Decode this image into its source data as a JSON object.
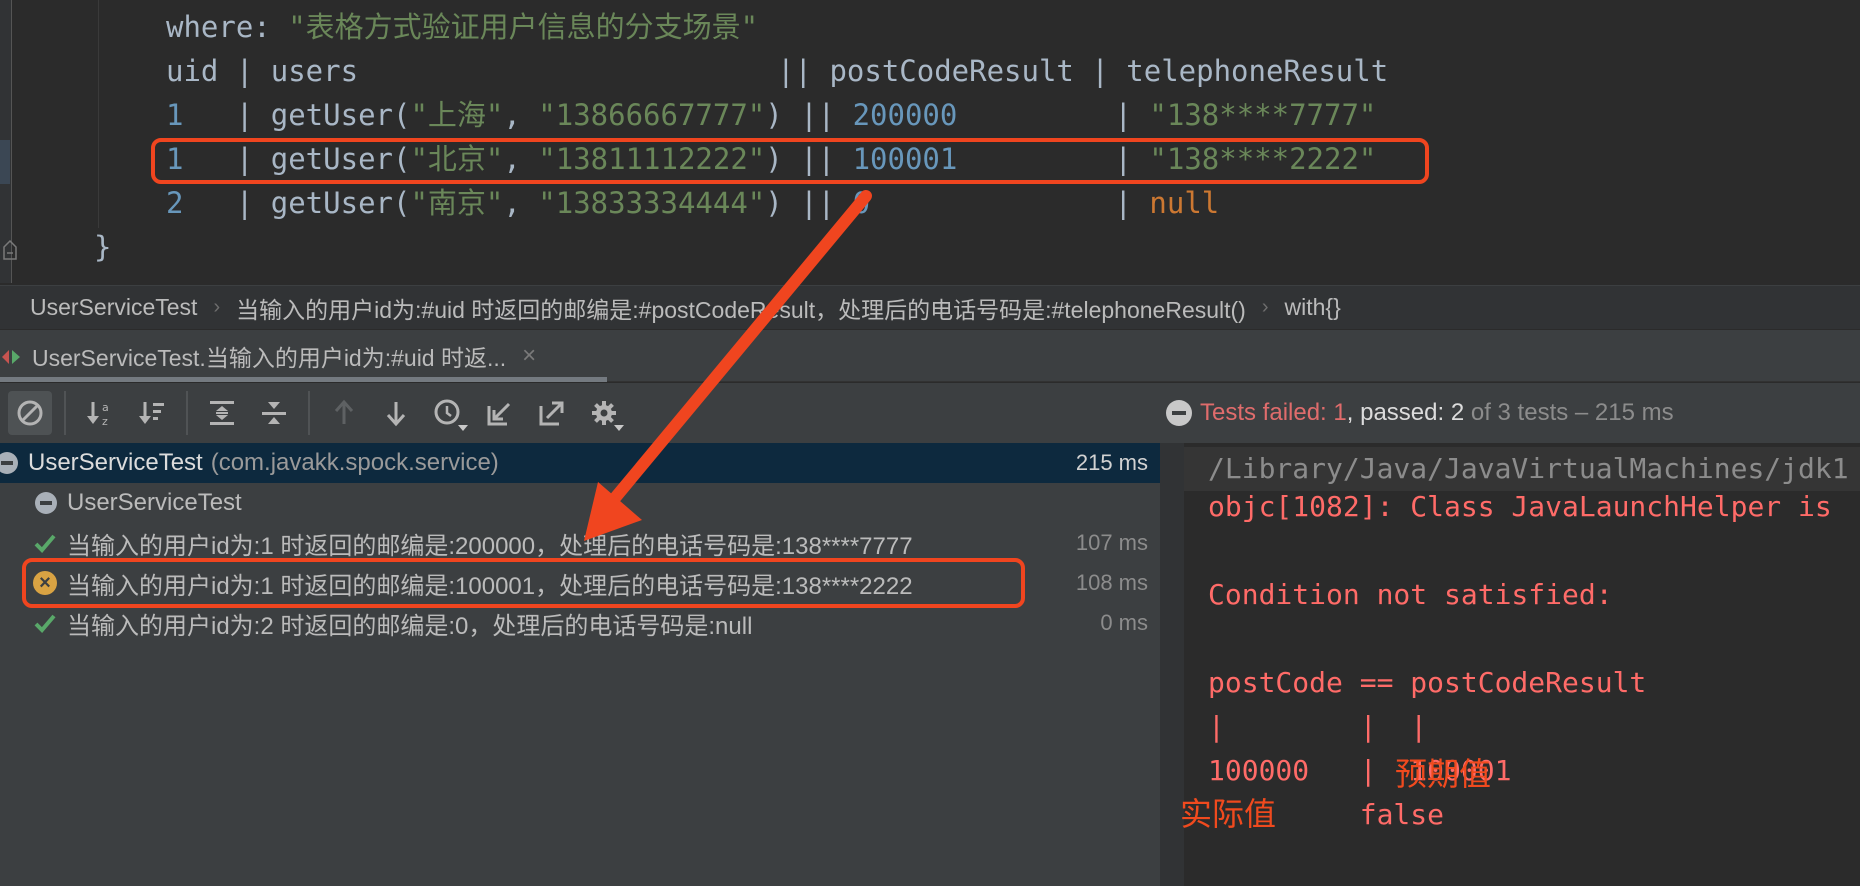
{
  "editor": {
    "lines": [
      {
        "segments": [
          {
            "t": "where: ",
            "c": "plain"
          },
          {
            "t": "\"表格方式验证用户信息的分支场景\"",
            "c": "str"
          }
        ]
      },
      {
        "segments": [
          {
            "t": "uid | users                        || postCodeResult | telephoneResult",
            "c": "plain"
          }
        ]
      },
      {
        "segments": [
          {
            "t": "1",
            "c": "num"
          },
          {
            "t": "   | getUser(",
            "c": "plain"
          },
          {
            "t": "\"上海\"",
            "c": "str"
          },
          {
            "t": ", ",
            "c": "plain"
          },
          {
            "t": "\"13866667777\"",
            "c": "str"
          },
          {
            "t": ") || ",
            "c": "plain"
          },
          {
            "t": "200000",
            "c": "num"
          },
          {
            "t": "         | ",
            "c": "plain"
          },
          {
            "t": "\"138****7777\"",
            "c": "str"
          }
        ]
      },
      {
        "segments": [
          {
            "t": "1",
            "c": "num"
          },
          {
            "t": "   | getUser(",
            "c": "plain"
          },
          {
            "t": "\"北京\"",
            "c": "str"
          },
          {
            "t": ", ",
            "c": "plain"
          },
          {
            "t": "\"13811112222\"",
            "c": "str"
          },
          {
            "t": ") || ",
            "c": "plain"
          },
          {
            "t": "100001",
            "c": "num"
          },
          {
            "t": "         | ",
            "c": "plain"
          },
          {
            "t": "\"138****2222\"",
            "c": "str"
          }
        ]
      },
      {
        "segments": [
          {
            "t": "2",
            "c": "num"
          },
          {
            "t": "   | getUser(",
            "c": "plain"
          },
          {
            "t": "\"南京\"",
            "c": "str"
          },
          {
            "t": ", ",
            "c": "plain"
          },
          {
            "t": "\"13833334444\"",
            "c": "str"
          },
          {
            "t": ") || ",
            "c": "plain"
          },
          {
            "t": "0",
            "c": "num"
          },
          {
            "t": "              | ",
            "c": "plain"
          },
          {
            "t": "null",
            "c": "kw"
          }
        ]
      },
      {
        "segments": [
          {
            "t": "}",
            "c": "plain"
          }
        ]
      }
    ]
  },
  "breadcrumb": {
    "items": [
      "UserServiceTest",
      "当输入的用户id为:#uid 时返回的邮编是:#postCodeResult，处理后的电话号码是:#telephoneResult()",
      "with{}"
    ],
    "separator": "›"
  },
  "run_tab": {
    "label": "UserServiceTest.当输入的用户id为:#uid 时返...",
    "close": "×"
  },
  "toolbar": {
    "buttons": [
      {
        "name": "stop-rerun-icon",
        "active": true
      },
      {
        "name": "sort-alphabetically-icon"
      },
      {
        "name": "sort-by-duration-icon"
      },
      {
        "name": "expand-all-icon"
      },
      {
        "name": "collapse-all-icon"
      },
      {
        "name": "previous-failed-test-icon",
        "disabled": true
      },
      {
        "name": "next-failed-test-icon"
      },
      {
        "name": "test-history-icon"
      },
      {
        "name": "import-tests-icon"
      },
      {
        "name": "export-tests-icon"
      },
      {
        "name": "settings-gear-icon"
      }
    ]
  },
  "status": {
    "failed_label": "Tests failed: ",
    "failed_count": "1",
    "passed_label": ", passed: ",
    "passed_count": "2",
    "total": " of 3 tests – 215 ms"
  },
  "tree": {
    "root": {
      "label": "UserServiceTest",
      "package": "(com.javakk.spock.service)",
      "time": "215 ms"
    },
    "suite": {
      "label": "UserServiceTest"
    },
    "tests": [
      {
        "status": "passed",
        "label": "当输入的用户id为:1 时返回的邮编是:200000，处理后的电话号码是:138****7777",
        "time": "107 ms"
      },
      {
        "status": "failed",
        "label": "当输入的用户id为:1 时返回的邮编是:100001，处理后的电话号码是:138****2222",
        "time": "108 ms"
      },
      {
        "status": "passed",
        "label": "当输入的用户id为:2 时返回的邮编是:0，处理后的电话号码是:null",
        "time": "0 ms"
      }
    ]
  },
  "console": {
    "lines": [
      {
        "text": "/Library/Java/JavaVirtualMachines/jdk1",
        "kind": "cmd"
      },
      {
        "text": "objc[1082]: Class JavaLaunchHelper is",
        "kind": "err"
      },
      {
        "text": "",
        "kind": "err"
      },
      {
        "text": "Condition not satisfied:",
        "kind": "err"
      },
      {
        "text": "",
        "kind": "err"
      },
      {
        "text": "postCode == postCodeResult",
        "kind": "err"
      },
      {
        "text": "|        |  |",
        "kind": "err"
      },
      {
        "text": "100000   |  100001",
        "kind": "err"
      },
      {
        "text": "         false",
        "kind": "err"
      }
    ],
    "annotations": {
      "expected": "预期值",
      "actual": "实际值"
    }
  },
  "colors": {
    "annotation_red": "#f0451f",
    "error_text": "#ff6b68",
    "string_green": "#6a8759",
    "number_blue": "#6897bb",
    "keyword_orange": "#cc7832",
    "selected_row": "#0d293e",
    "pass_green": "#59a869",
    "fail_yellow": "#d9a343"
  }
}
